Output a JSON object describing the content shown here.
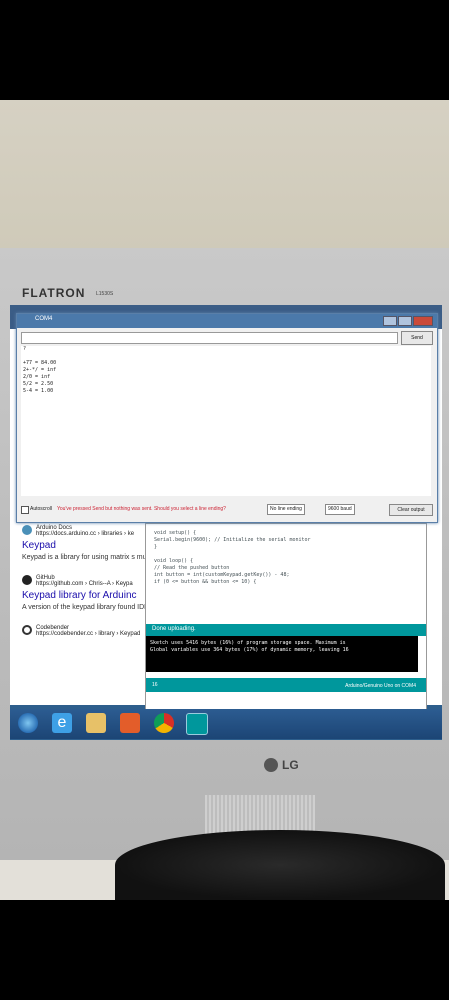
{
  "monitor": {
    "brand": "FLATRON",
    "model": "L1530S",
    "maker": "LG"
  },
  "serial_monitor": {
    "title": "COM4",
    "send_label": "Send",
    "output": [
      "?",
      "",
      "+77 = 84.00",
      "2+-*/ = inf",
      "2/0 = inf",
      "5/2 = 2.50",
      "5-4 = 1.00"
    ],
    "autoscroll_label": "Autoscroll",
    "warning": "You've pressed Send but nothing was sent. Should you select a line ending?",
    "line_ending": "No line ending",
    "baud": "9600 baud",
    "clear_label": "Clear output"
  },
  "browser_results": [
    {
      "source": "Arduino Docs",
      "url": "https://docs.arduino.cc › libraries › ke",
      "title": "Keypad",
      "snippet": "Keypad is a library for using matrix s multiple keypresses."
    },
    {
      "source": "GitHub",
      "url": "https://github.com › Chris--A › Keypa",
      "title": "Keypad library for Arduinc",
      "snippet": "A version of the keypad library found IDE library manager."
    },
    {
      "source": "Codebender",
      "url": "https://codebender.cc › library › Keypad",
      "title": "",
      "snippet": ""
    }
  ],
  "ide": {
    "code": [
      "void setup() {",
      "  Serial.begin(9600);   // Initialize the serial monitor",
      "}",
      "",
      "void loop() {",
      "  // Read the pushed button",
      "  int button = int(customKeypad.getKey()) - 48;",
      "  if (0 <= button && button <= 10) {"
    ],
    "status": "Done uploading.",
    "console": [
      "Sketch uses 5416 bytes (16%) of program storage space. Maximum is",
      "Global variables use 364 bytes (17%) of dynamic memory, leaving 16"
    ],
    "line_no": "16",
    "board": "Arduino/Genuino Uno on COM4"
  }
}
